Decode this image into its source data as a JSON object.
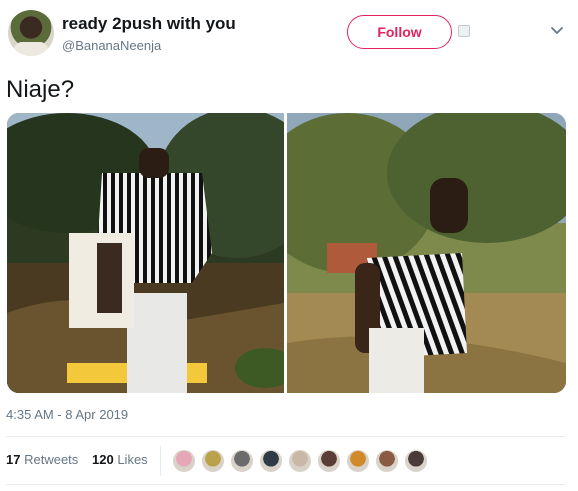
{
  "user": {
    "display_name": "ready 2push with you",
    "handle": "@BananaNeenja"
  },
  "follow_label": "Follow",
  "tweet": {
    "text": "Niaje?",
    "timestamp": "4:35 AM - 8 Apr 2019"
  },
  "stats": {
    "retweets_count": "17",
    "retweets_label": "Retweets",
    "likes_count": "120",
    "likes_label": "Likes"
  },
  "likers": [
    {
      "color": "#e6a6b8"
    },
    {
      "color": "#b9a24a"
    },
    {
      "color": "#6b6b6b"
    },
    {
      "color": "#2f3b47"
    },
    {
      "color": "#c9b8a5"
    },
    {
      "color": "#5a3d36"
    },
    {
      "color": "#d08a2a"
    },
    {
      "color": "#8a5a44"
    },
    {
      "color": "#4a3a3a"
    }
  ],
  "colors": {
    "follow_accent": "#e0245e",
    "secondary_text": "#657786",
    "primary_text": "#14171a"
  }
}
